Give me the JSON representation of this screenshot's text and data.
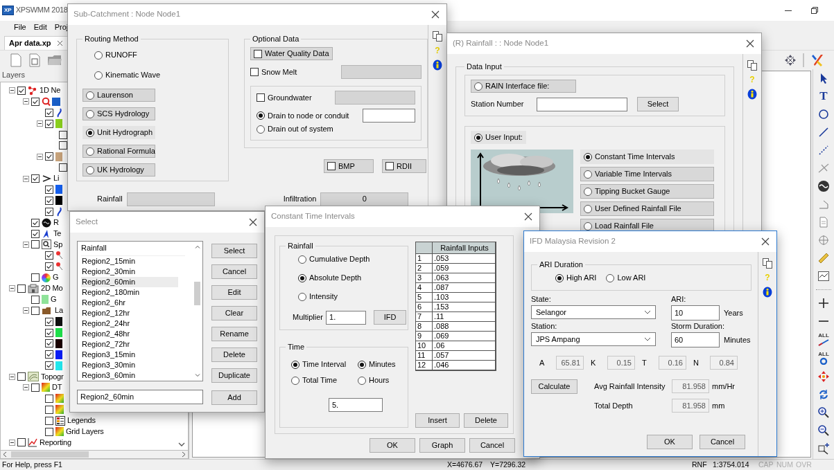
{
  "main_window": {
    "logo_text": "XP",
    "title": "XPSWMM 2018",
    "menu": [
      "File",
      "Edit",
      "Proj"
    ],
    "document_tab": {
      "label": "Apr data.xp"
    },
    "layers_panel": {
      "title": "Layers",
      "tree": [
        {
          "label": "1D Ne",
          "checked": true,
          "expanded": true,
          "kind": "network",
          "children": [
            {
              "checked": true,
              "expanded": true,
              "kind": "query",
              "children": [
                {
                  "checked": true,
                  "kind": "curve"
                },
                {
                  "checked": true,
                  "expanded": true,
                  "kind": "swatch",
                  "color": "#8cd21e",
                  "children": [
                    {
                      "checked": false
                    },
                    {
                      "checked": false
                    }
                  ]
                },
                {
                  "checked": true,
                  "expanded": true,
                  "kind": "swatch",
                  "color": "#c9a47c",
                  "children": [
                    {
                      "checked": false
                    }
                  ]
                }
              ]
            },
            {
              "label": "Li",
              "checked": true,
              "expanded": true,
              "kind": "chevron",
              "children": [
                {
                  "checked": true,
                  "kind": "swatch",
                  "color": "#1560f0"
                },
                {
                  "checked": true,
                  "kind": "swatch",
                  "color": "#000000"
                },
                {
                  "checked": true,
                  "kind": "curve"
                }
              ]
            },
            {
              "label": "R",
              "checked": true,
              "kind": "gauge"
            },
            {
              "label": "Te",
              "checked": true,
              "kind": "pen"
            },
            {
              "label": "Sp",
              "checked": false,
              "expanded": true,
              "kind": "spatial",
              "children": [
                {
                  "checked": true,
                  "kind": "pin"
                },
                {
                  "checked": true,
                  "kind": "pin"
                }
              ]
            },
            {
              "label": "G",
              "checked": false,
              "kind": "wheel"
            }
          ]
        },
        {
          "label": "2D Mo",
          "checked": false,
          "expanded": true,
          "kind": "model",
          "children": [
            {
              "label": "G",
              "checked": false,
              "kind": "swatch",
              "color": "#8fe39a"
            },
            {
              "label": "La",
              "checked": false,
              "expanded": true,
              "kind": "folder",
              "children": [
                {
                  "checked": true,
                  "kind": "swatch",
                  "color": "#111111"
                },
                {
                  "checked": true,
                  "kind": "swatch",
                  "color": "#1ee04a"
                },
                {
                  "checked": true,
                  "kind": "swatch",
                  "color": "#1a0000"
                },
                {
                  "checked": true,
                  "kind": "swatch",
                  "color": "#0a1ef5"
                },
                {
                  "checked": true,
                  "kind": "swatch",
                  "color": "#22e8ee"
                }
              ]
            }
          ]
        },
        {
          "label": "Topogr",
          "checked": false,
          "expanded": true,
          "kind": "contour",
          "children": [
            {
              "label": "DT",
              "checked": false,
              "expanded": true,
              "kind": "gradient",
              "children": [
                {
                  "checked": false,
                  "kind": "gradient"
                },
                {
                  "checked": false,
                  "kind": "gradient"
                },
                {
                  "label": "Legends",
                  "checked": false,
                  "kind": "legend"
                },
                {
                  "label": "Grid Layers",
                  "checked": false,
                  "kind": "gradient"
                }
              ]
            }
          ]
        },
        {
          "label": "Reporting",
          "checked": false,
          "expanded": true,
          "kind": "chart"
        }
      ]
    },
    "vertical_toolbar": [
      {
        "kind": "pointer"
      },
      {
        "kind": "text",
        "glyph": "T"
      },
      {
        "kind": "circle"
      },
      {
        "kind": "line"
      },
      {
        "kind": "dashed"
      },
      {
        "kind": "cross"
      },
      {
        "kind": "gauge"
      },
      {
        "kind": "angle"
      },
      {
        "kind": "page"
      },
      {
        "kind": "target"
      },
      {
        "kind": "ruler"
      },
      {
        "kind": "chart"
      },
      {
        "kind": "separator"
      },
      {
        "kind": "plus"
      },
      {
        "kind": "minus"
      },
      {
        "kind": "all_line",
        "glyph": "ALL"
      },
      {
        "kind": "all_circle",
        "glyph": "ALL"
      },
      {
        "kind": "move"
      },
      {
        "kind": "refresh"
      },
      {
        "kind": "zoom_in"
      },
      {
        "kind": "zoom_out"
      },
      {
        "kind": "zoom_plus"
      }
    ],
    "status_bar": {
      "help": "For Help, press F1",
      "x_coord": "X=4676.67",
      "y_coord": "Y=7296.32",
      "layer": "RNF",
      "scale": "1:3754.014",
      "indicators": [
        {
          "label": "CAP",
          "on": false
        },
        {
          "label": "NUM",
          "on": false
        },
        {
          "label": "OVR",
          "on": false
        }
      ]
    }
  },
  "sub_catchment": {
    "title": "Sub-Catchment : Node Node1",
    "active": false,
    "help_mark": "?",
    "routing_method": {
      "label": "Routing Method",
      "options": [
        {
          "label": "RUNOFF",
          "selected": false,
          "boxed": false
        },
        {
          "label": "Kinematic Wave",
          "selected": false,
          "boxed": false
        },
        {
          "label": "Laurenson",
          "selected": false,
          "boxed": true
        },
        {
          "label": "SCS Hydrology",
          "selected": false,
          "boxed": true
        },
        {
          "label": "Unit Hydrograph",
          "selected": true,
          "boxed": true
        },
        {
          "label": "Rational Formula",
          "selected": false,
          "boxed": true
        },
        {
          "label": "UK Hydrology",
          "selected": false,
          "boxed": true
        }
      ]
    },
    "optional_data": {
      "label": "Optional Data",
      "water_quality": {
        "label": "Water Quality Data",
        "checked": false,
        "boxed": true
      },
      "snow_melt": {
        "label": "Snow Melt",
        "checked": false,
        "boxed": false,
        "field": {
          "disabled": true
        }
      },
      "groundwater": {
        "label": "Groundwater",
        "checked": false,
        "boxed": false,
        "field": {
          "disabled": true
        }
      },
      "drain_options": [
        {
          "label": "Drain to node or conduit",
          "selected": true
        },
        {
          "label": "Drain out of system",
          "selected": false
        }
      ],
      "drain_field": {
        "disabled": false
      }
    },
    "flags": [
      {
        "label": "BMP",
        "checked": false,
        "boxed": true
      },
      {
        "label": "RDII",
        "checked": false,
        "boxed": true
      }
    ],
    "rainfall": {
      "label": "Rainfall",
      "disabled": true
    },
    "infiltration": {
      "label": "Infiltration",
      "value": "0",
      "disabled": true
    }
  },
  "rainfall": {
    "title": "(R) Rainfall : : Node Node1",
    "active": false,
    "help_mark": "?",
    "data_input": {
      "label": "Data Input",
      "rain_interface": {
        "label": "RAIN Interface file:",
        "selected": false,
        "boxed": true
      },
      "station_number": {
        "label": "Station Number"
      },
      "select_button": "Select",
      "user_input": {
        "label": "User Input:",
        "selected": true,
        "boxed": true
      },
      "input_types": [
        {
          "label": "Constant Time Intervals",
          "selected": true,
          "boxed": true
        },
        {
          "label": "Variable Time Intervals",
          "selected": false,
          "boxed": true
        },
        {
          "label": "Tipping Bucket Gauge",
          "selected": false,
          "boxed": true
        },
        {
          "label": "User Defined Rainfall File",
          "selected": false,
          "boxed": true
        },
        {
          "label": "Load Rainfall File",
          "selected": false,
          "boxed": true
        }
      ]
    }
  },
  "select_dialog": {
    "title": "Select",
    "active": false,
    "list_header": "Rainfall",
    "items": [
      {
        "label": "Region2_15min",
        "selected": false
      },
      {
        "label": "Region2_30min",
        "selected": false
      },
      {
        "label": "Region2_60min",
        "selected": true
      },
      {
        "label": "Region2_180min",
        "selected": false
      },
      {
        "label": "Region2_6hr",
        "selected": false
      },
      {
        "label": "Region2_12hr",
        "selected": false
      },
      {
        "label": "Region2_24hr",
        "selected": false
      },
      {
        "label": "Region2_48hr",
        "selected": false
      },
      {
        "label": "Region2_72hr",
        "selected": false
      },
      {
        "label": "Region3_15min",
        "selected": false
      },
      {
        "label": "Region3_30min",
        "selected": false
      },
      {
        "label": "Region3_60min",
        "selected": false
      }
    ],
    "name_field": {
      "value": "Region2_60min"
    },
    "buttons": [
      "Select",
      "Cancel",
      "Edit",
      "Clear",
      "Rename",
      "Delete",
      "Duplicate"
    ],
    "add_button": "Add"
  },
  "constant_time_intervals": {
    "title": "Constant Time Intervals",
    "active": false,
    "rainfall_group": {
      "label": "Rainfall",
      "options": [
        {
          "label": "Cumulative Depth",
          "selected": false
        },
        {
          "label": "Absolute Depth",
          "selected": true
        },
        {
          "label": "Intensity",
          "selected": false
        }
      ]
    },
    "multiplier": {
      "label": "Multiplier",
      "value": "1."
    },
    "ifd_button": "IFD",
    "time_group": {
      "label": "Time",
      "mode_options": [
        {
          "label": "Time Interval",
          "selected": true
        },
        {
          "label": "Total Time",
          "selected": false
        }
      ],
      "unit_options": [
        {
          "label": "Minutes",
          "selected": true
        },
        {
          "label": "Hours",
          "selected": false
        }
      ],
      "value": "5."
    },
    "table": {
      "column": "Rainfall Inputs",
      "rows": [
        {
          "index": "1",
          "value": ".053"
        },
        {
          "index": "2",
          "value": ".059"
        },
        {
          "index": "3",
          "value": ".063"
        },
        {
          "index": "4",
          "value": ".087"
        },
        {
          "index": "5",
          "value": ".103"
        },
        {
          "index": "6",
          "value": ".153"
        },
        {
          "index": "7",
          "value": ".11"
        },
        {
          "index": "8",
          "value": ".088"
        },
        {
          "index": "9",
          "value": ".069"
        },
        {
          "index": "10",
          "value": ".06"
        },
        {
          "index": "11",
          "value": ".057"
        },
        {
          "index": "12",
          "value": ".046"
        }
      ]
    },
    "table_buttons": [
      "Insert",
      "Delete"
    ],
    "buttons": [
      "OK",
      "Graph",
      "Cancel"
    ]
  },
  "ifd_dialog": {
    "title": "IFD Malaysia Revision 2",
    "active": true,
    "help_mark": "?",
    "ari_duration": {
      "label": "ARI Duration",
      "options": [
        {
          "label": "High ARI",
          "selected": true
        },
        {
          "label": "Low ARI",
          "selected": false
        }
      ]
    },
    "state": {
      "label": "State:",
      "value": "Selangor"
    },
    "ari": {
      "label": "ARI:",
      "value": "10",
      "unit": "Years"
    },
    "station": {
      "label": "Station:",
      "value": "JPS Ampang"
    },
    "storm_duration": {
      "label": "Storm Duration:",
      "value": "60",
      "unit": "Minutes"
    },
    "coefficients": [
      {
        "label": "A",
        "value": "65.81"
      },
      {
        "label": "K",
        "value": "0.15"
      },
      {
        "label": "T",
        "value": "0.16"
      },
      {
        "label": "N",
        "value": "0.84"
      }
    ],
    "calculate_button": "Calculate",
    "avg_intensity": {
      "label": "Avg Rainfall Intensity",
      "value": "81.958",
      "unit": "mm/Hr"
    },
    "total_depth": {
      "label": "Total Depth",
      "value": "81.958",
      "unit": "mm"
    },
    "buttons": [
      "OK",
      "Cancel"
    ]
  }
}
